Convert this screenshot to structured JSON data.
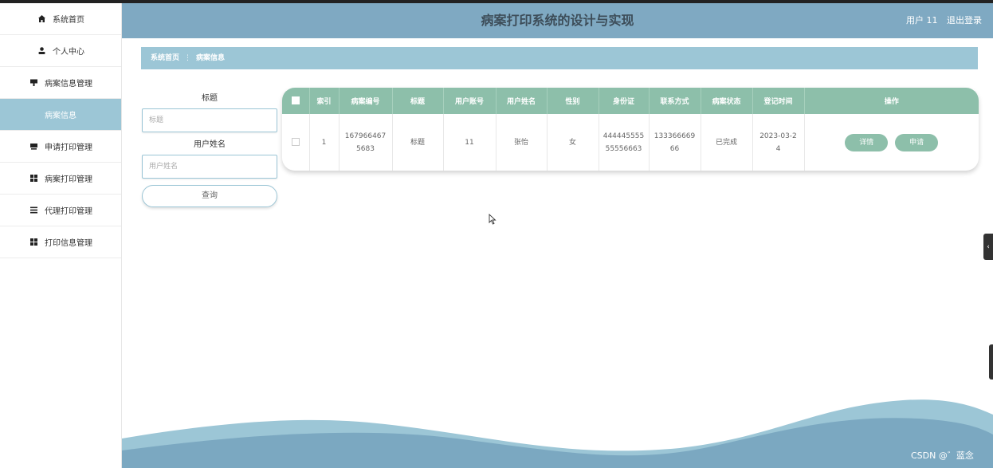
{
  "header": {
    "title": "病案打印系统的设计与实现",
    "user": "用户 11",
    "logout": "退出登录"
  },
  "sidebar": {
    "items": [
      {
        "icon": "home-icon",
        "label": "系统首页"
      },
      {
        "icon": "person-icon",
        "label": "个人中心"
      },
      {
        "icon": "record-icon",
        "label": "病案信息管理"
      },
      {
        "icon": "",
        "label": "病案信息",
        "sub": true
      },
      {
        "icon": "print-icon",
        "label": "申请打印管理"
      },
      {
        "icon": "grid-icon",
        "label": "病案打印管理"
      },
      {
        "icon": "list-icon",
        "label": "代理打印管理"
      },
      {
        "icon": "grid-icon",
        "label": "打印信息管理"
      }
    ]
  },
  "breadcrumb": {
    "home": "系统首页",
    "current": "病案信息"
  },
  "search": {
    "title_label": "标题",
    "title_placeholder": "标题",
    "name_label": "用户姓名",
    "name_placeholder": "用户姓名",
    "query_button": "查询"
  },
  "table": {
    "headers": [
      "索引",
      "病案编号",
      "标题",
      "用户账号",
      "用户姓名",
      "性别",
      "身份证",
      "联系方式",
      "病案状态",
      "登记时间",
      "操作"
    ],
    "rows": [
      {
        "index": "1",
        "record_no": "1679664675683",
        "title": "标题",
        "account": "11",
        "name": "张怡",
        "gender": "女",
        "id_card": "44444555555556663",
        "phone": "13336666966",
        "status": "已完成",
        "reg_time": "2023-03-24",
        "detail_btn": "详情",
        "apply_btn": "申请"
      }
    ]
  },
  "watermark": "CSDN @゛蓝念",
  "colors": {
    "header": "#7fa9c2",
    "breadcrumb": "#9cc6d6",
    "table_header": "#8dbfaa",
    "wave_light": "#9cc6d6",
    "wave_dark": "#7ba8c1"
  }
}
